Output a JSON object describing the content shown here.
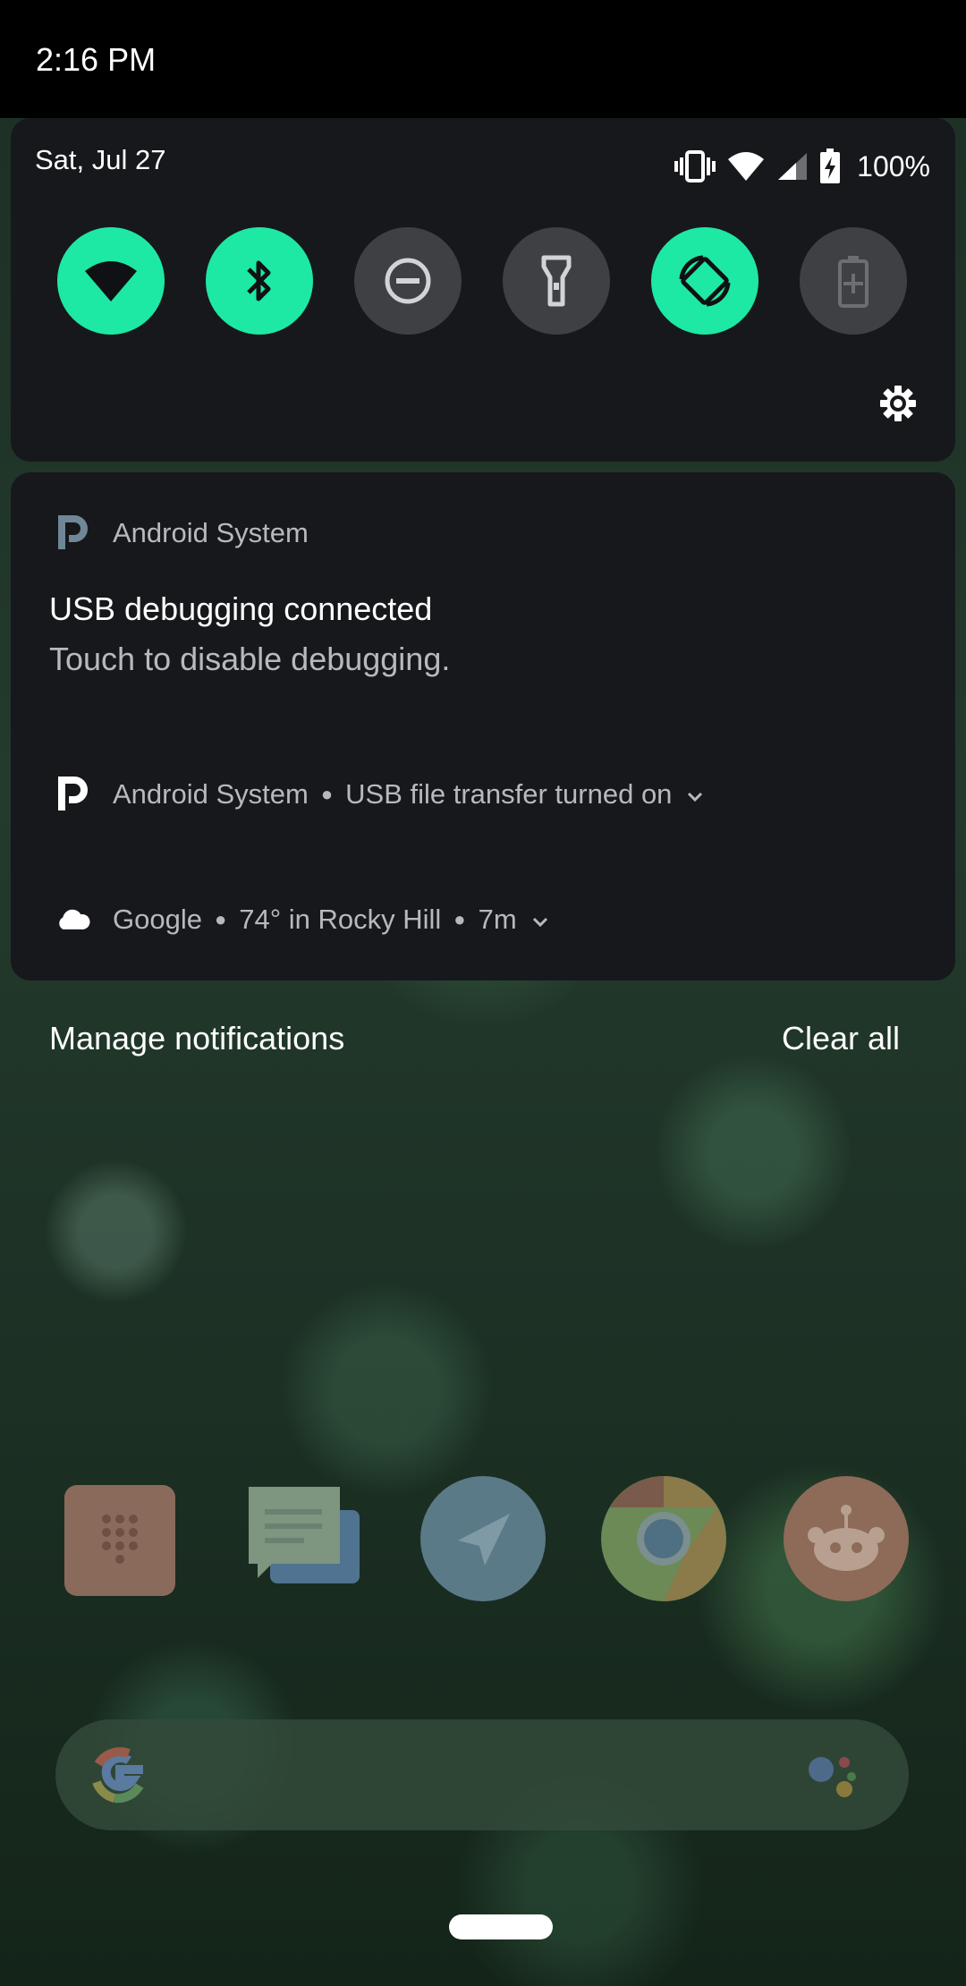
{
  "status_bar": {
    "time": "2:16 PM"
  },
  "quick_settings": {
    "date": "Sat, Jul 27",
    "battery_percent": "100%",
    "tiles": [
      {
        "name": "wifi",
        "icon": "wifi-icon",
        "state": "on"
      },
      {
        "name": "bluetooth",
        "icon": "bluetooth-icon",
        "state": "on"
      },
      {
        "name": "do-not-disturb",
        "icon": "do-not-disturb-icon",
        "state": "off"
      },
      {
        "name": "flashlight",
        "icon": "flashlight-icon",
        "state": "off"
      },
      {
        "name": "auto-rotate",
        "icon": "auto-rotate-icon",
        "state": "on"
      },
      {
        "name": "battery-saver",
        "icon": "battery-saver-icon",
        "state": "off"
      }
    ],
    "settings_icon": "gear-icon",
    "accent_color": "#1de9a4"
  },
  "notifications": {
    "usb_debugging": {
      "app": "Android System",
      "title": "USB debugging connected",
      "body": "Touch to disable debugging."
    },
    "usb_transfer": {
      "app": "Android System",
      "summary": "USB file transfer turned on"
    },
    "weather": {
      "app": "Google",
      "summary": "74° in Rocky Hill",
      "time": "7m"
    }
  },
  "actions": {
    "manage": "Manage notifications",
    "clear_all": "Clear all"
  },
  "dock": {
    "apps": [
      "phone-icon",
      "messages-icon",
      "direct-icon",
      "chrome-icon",
      "reddit-icon"
    ]
  }
}
